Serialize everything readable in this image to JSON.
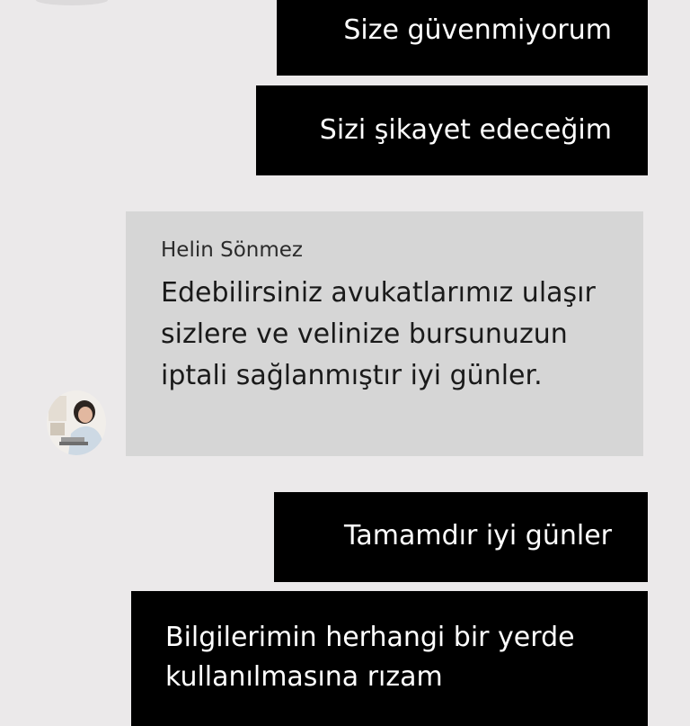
{
  "messages": [
    {
      "direction": "outgoing",
      "text": "Size güvenmiyorum"
    },
    {
      "direction": "outgoing",
      "text": "Sizi şikayet edeceğim"
    },
    {
      "direction": "incoming",
      "sender": "Helin Sönmez",
      "text": "Edebilirsiniz avukatlarımız ulaşır sizlere ve velinize bursunuzun iptali sağlanmıştır iyi günler."
    },
    {
      "direction": "outgoing",
      "text": "Tamamdır iyi günler"
    },
    {
      "direction": "outgoing",
      "text": "Bilgilerimin herhangi bir yerde kullanılmasına rızam"
    }
  ],
  "colors": {
    "background": "#ebe9ea",
    "outgoing_bubble": "#000000",
    "outgoing_text": "#ffffff",
    "incoming_bubble": "#d6d6d6",
    "incoming_text": "#1a1a1a"
  },
  "avatar_icon": "person-at-laptop"
}
